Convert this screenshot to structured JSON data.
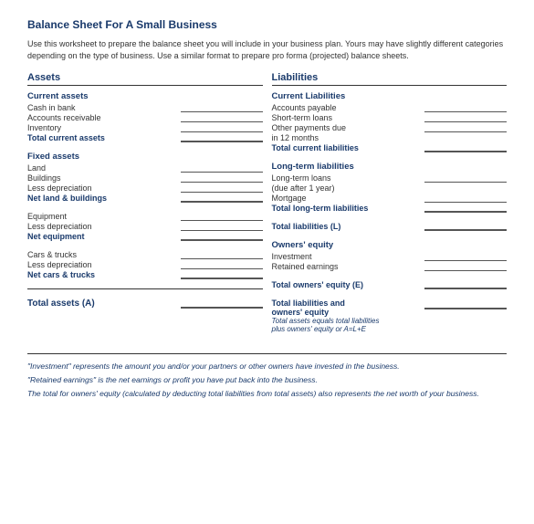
{
  "title": "Balance Sheet For A Small Business",
  "intro": "Use this worksheet to prepare the balance sheet you will include in your business plan.  Yours may have slightly different categories depending on the type of business.  Use a similar format to prepare pro forma (projected) balance sheets.",
  "assets": {
    "header": "Assets",
    "current_assets": {
      "header": "Current assets",
      "items": [
        "Cash in bank",
        "Accounts receivable",
        "Inventory",
        "Total current assets"
      ],
      "bold": [
        false,
        false,
        false,
        true
      ]
    },
    "fixed_assets": {
      "header": "Fixed assets",
      "items": [
        "Land",
        "Buildings",
        "Less depreciation",
        "Net land & buildings"
      ],
      "bold": [
        false,
        false,
        false,
        true
      ]
    },
    "equipment": {
      "items": [
        "Equipment",
        "Less depreciation",
        "Net equipment"
      ],
      "bold": [
        false,
        false,
        true
      ]
    },
    "cars": {
      "items": [
        "Cars & trucks",
        "Less depreciation",
        "Net cars & trucks"
      ],
      "bold": [
        false,
        false,
        true
      ]
    },
    "total": "Total assets (A)"
  },
  "liabilities": {
    "header": "Liabilities",
    "current_liabilities": {
      "header": "Current Liabilities",
      "items": [
        "Accounts payable",
        "Short-term loans",
        "Other payments due",
        "in 12 months",
        "Total current liabilities"
      ],
      "bold": [
        false,
        false,
        false,
        false,
        true
      ]
    },
    "long_term": {
      "header": "Long-term liabilities",
      "items": [
        "Long-term loans",
        "(due after 1 year)",
        "Mortgage",
        "Total long-term liabilities"
      ],
      "bold": [
        false,
        false,
        false,
        true
      ]
    },
    "total_liabilities": "Total liabilities (L)",
    "owners_equity": {
      "header": "Owners' equity",
      "items": [
        "Investment",
        "Retained earnings"
      ],
      "bold": [
        false,
        false
      ]
    },
    "total_equity": "Total owners' equity (E)",
    "total_both": {
      "line1": "Total liabilities and",
      "line2": "owners' equity",
      "line3": "Total assets equals total liabilities",
      "line4": "plus owners' equity or A=L+E"
    }
  },
  "footer": {
    "note1": "\"Investment\" represents the amount you and/or your partners or other owners have invested in the business.",
    "note2": "\"Retained earnings\" is the net earnings or profit you have put back into the business.",
    "note3": "The total for owners' equity (calculated by deducting total liabilities from total assets) also represents the net worth of your business."
  }
}
